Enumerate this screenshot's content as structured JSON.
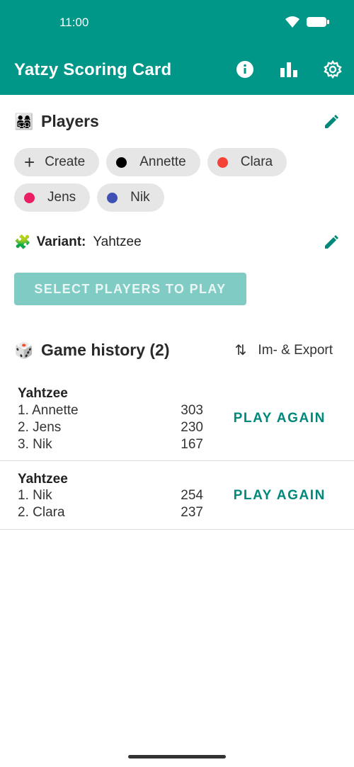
{
  "status": {
    "time": "11:00",
    "icons": [
      "wifi-icon",
      "battery-icon"
    ]
  },
  "appbar": {
    "title": "Yatzy Scoring Card",
    "actions": [
      "info-icon",
      "stats-icon",
      "settings-icon"
    ]
  },
  "players": {
    "emoji": "👨‍👩‍👧‍👦",
    "title": "Players",
    "create_label": "Create",
    "list": [
      {
        "name": "Annette",
        "color": "#000000"
      },
      {
        "name": "Clara",
        "color": "#f44336"
      },
      {
        "name": "Jens",
        "color": "#e91e63"
      },
      {
        "name": "Nik",
        "color": "#3f51b5"
      }
    ]
  },
  "variant": {
    "emoji": "🧩",
    "label": "Variant:",
    "value": "Yahtzee"
  },
  "select_button": "SELECT PLAYERS TO PLAY",
  "history": {
    "emoji": "🎲",
    "title": "Game history (2)",
    "export_label": "Im- & Export",
    "games": [
      {
        "variant": "Yahtzee",
        "results": [
          {
            "rank": "1. Annette",
            "score": "303"
          },
          {
            "rank": "2. Jens",
            "score": "230"
          },
          {
            "rank": "3. Nik",
            "score": "167"
          }
        ],
        "action": "PLAY AGAIN"
      },
      {
        "variant": "Yahtzee",
        "results": [
          {
            "rank": "1. Nik",
            "score": "254"
          },
          {
            "rank": "2. Clara",
            "score": "237"
          }
        ],
        "action": "PLAY AGAIN"
      }
    ]
  },
  "colors": {
    "primary": "#009688",
    "accent": "#00897b",
    "disabled_button": "#80cbc4"
  }
}
